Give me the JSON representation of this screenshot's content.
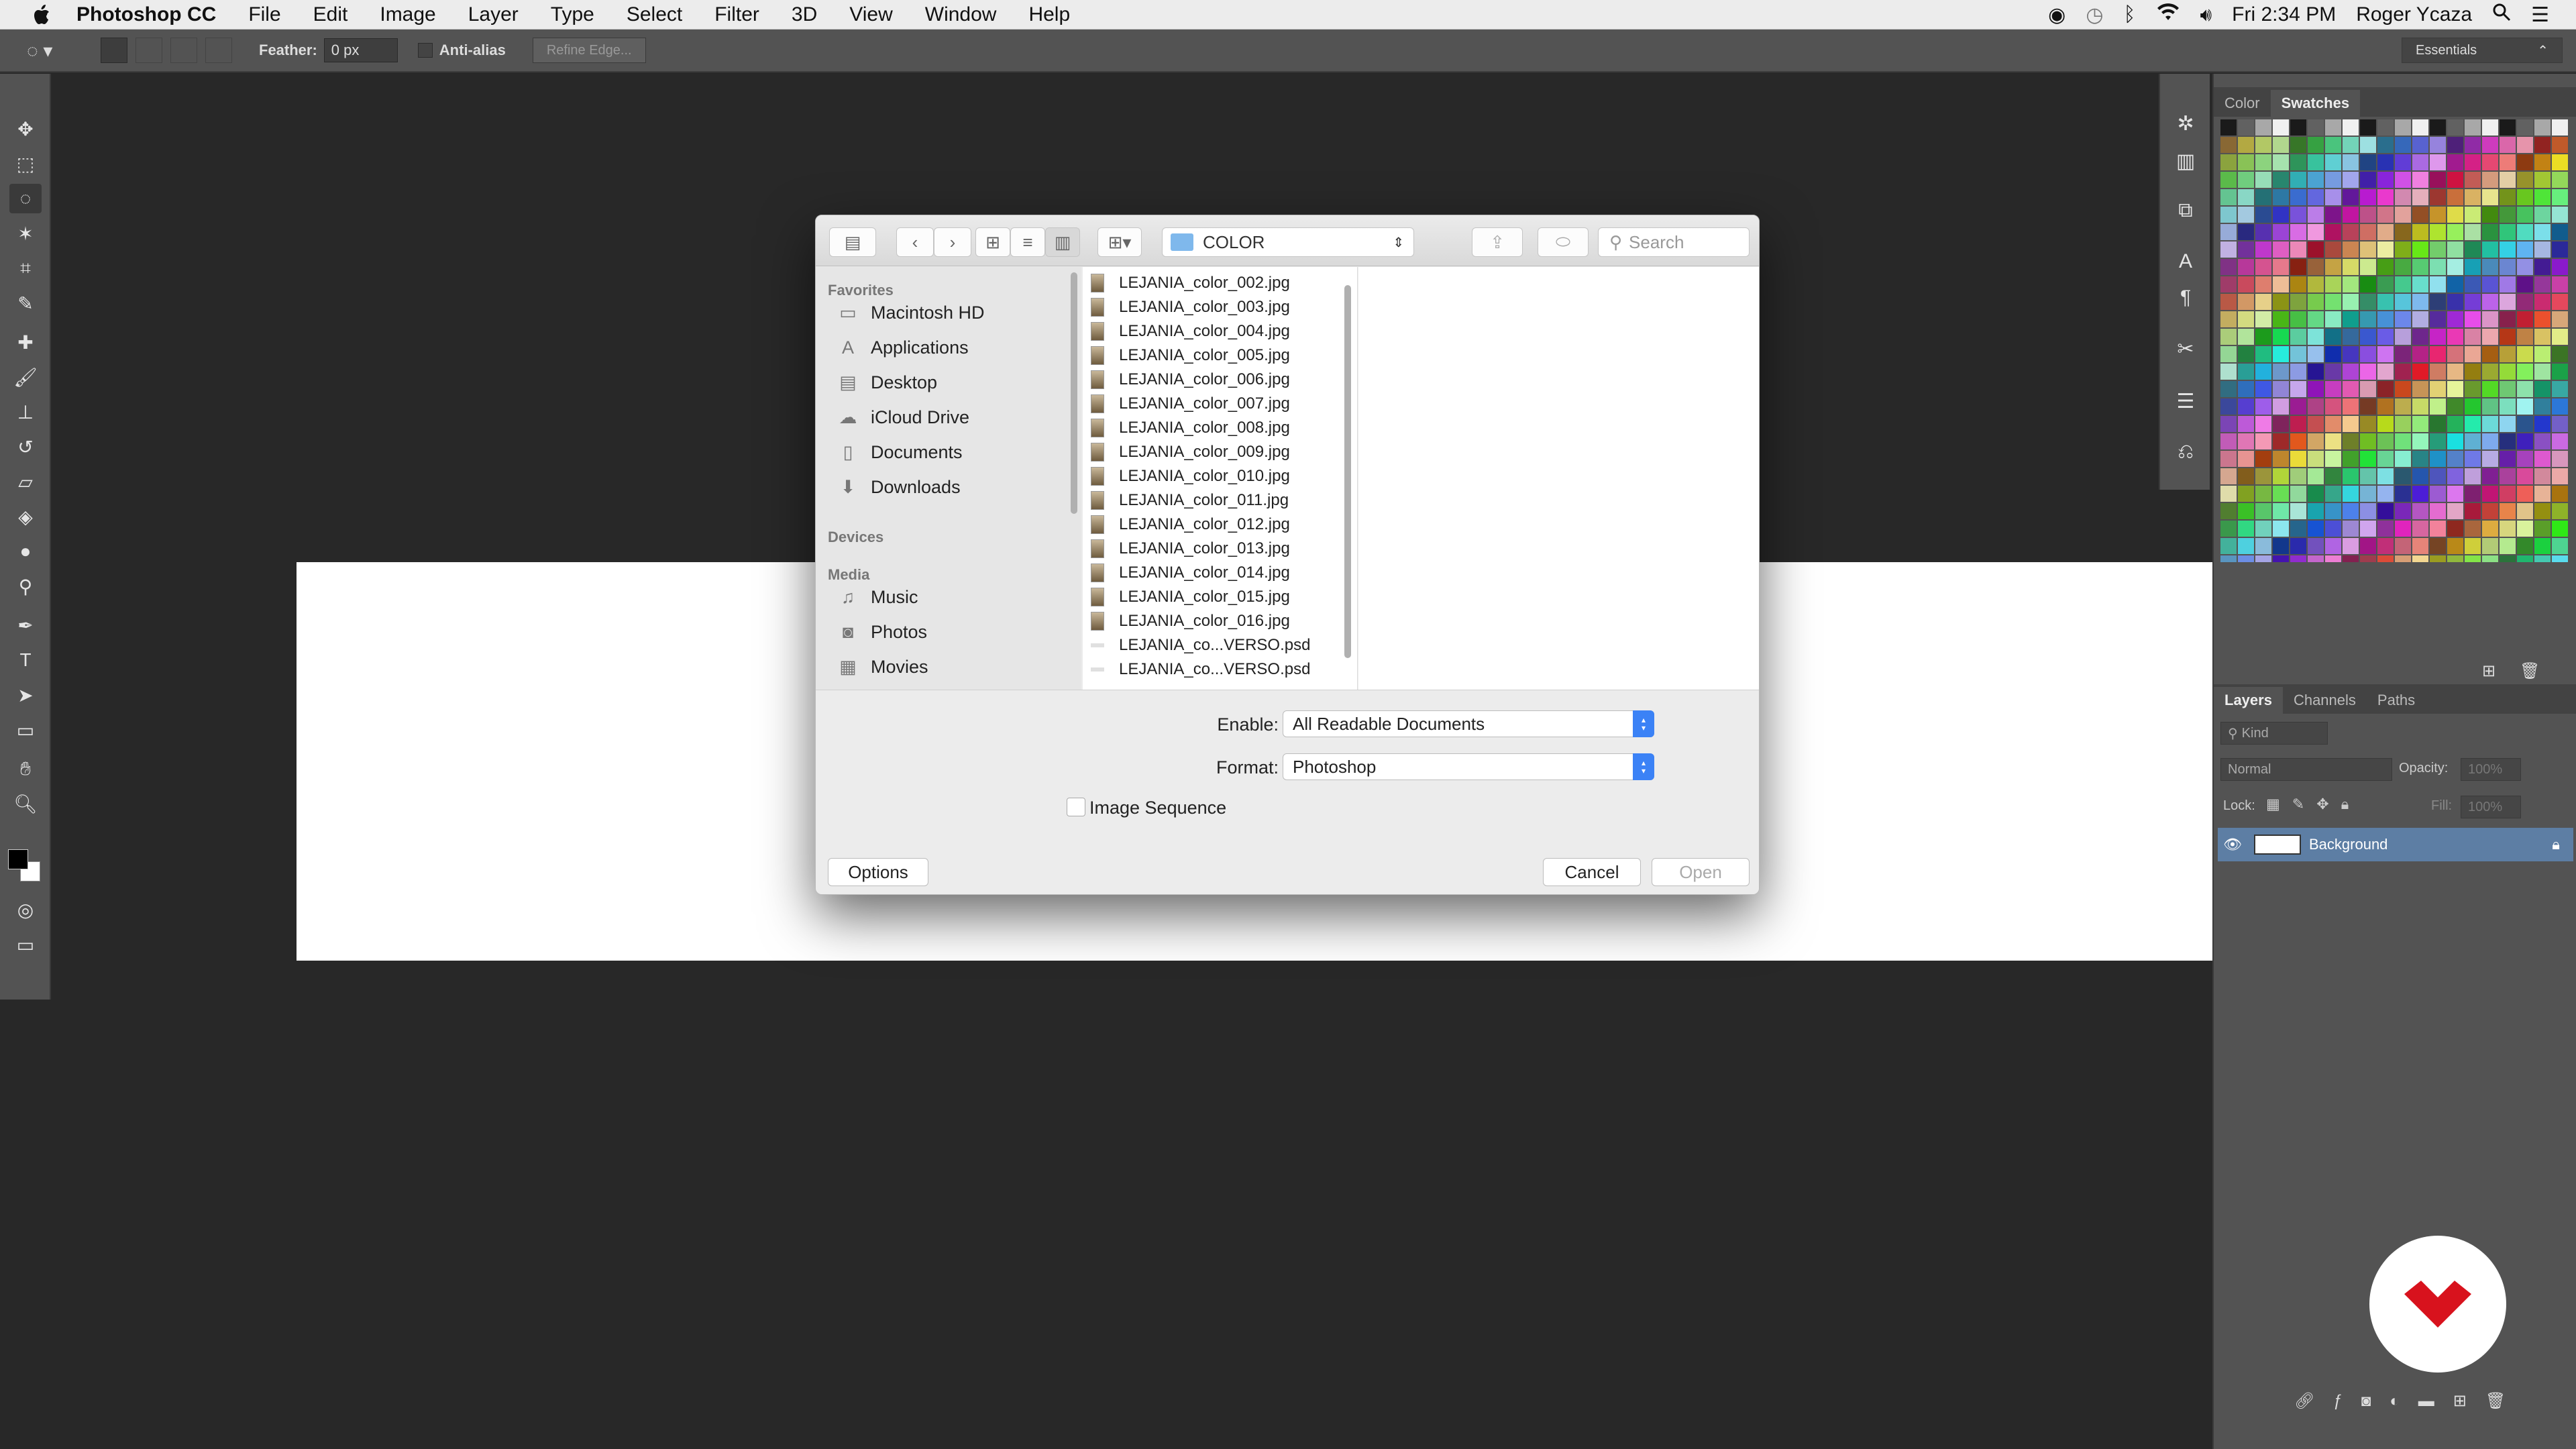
{
  "menubar": {
    "app_name": "Photoshop CC",
    "items": [
      "File",
      "Edit",
      "Image",
      "Layer",
      "Type",
      "Select",
      "Filter",
      "3D",
      "View",
      "Window",
      "Help"
    ],
    "clock": "Fri 2:34 PM",
    "user": "Roger Ycaza"
  },
  "options_bar": {
    "feather_label": "Feather:",
    "feather_value": "0 px",
    "anti_alias_label": "Anti-alias",
    "refine_edge_label": "Refine Edge...",
    "workspace": "Essentials"
  },
  "panels": {
    "color_tabs": [
      "Color",
      "Swatches"
    ],
    "layers_tabs": [
      "Layers",
      "Channels",
      "Paths"
    ],
    "kind_filter": "Kind",
    "blend_mode": "Normal",
    "opacity_label": "Opacity:",
    "opacity_value": "100%",
    "lock_label": "Lock:",
    "fill_label": "Fill:",
    "fill_value": "100%",
    "layer_name": "Background"
  },
  "dialog": {
    "location": "COLOR",
    "search_placeholder": "Search",
    "sidebar": {
      "favorites_heading": "Favorites",
      "favorites": [
        "Macintosh HD",
        "Applications",
        "Desktop",
        "iCloud Drive",
        "Documents",
        "Downloads"
      ],
      "devices_heading": "Devices",
      "media_heading": "Media",
      "media": [
        "Music",
        "Photos",
        "Movies"
      ]
    },
    "files": [
      "LEJANIA_color_002.jpg",
      "LEJANIA_color_003.jpg",
      "LEJANIA_color_004.jpg",
      "LEJANIA_color_005.jpg",
      "LEJANIA_color_006.jpg",
      "LEJANIA_color_007.jpg",
      "LEJANIA_color_008.jpg",
      "LEJANIA_color_009.jpg",
      "LEJANIA_color_010.jpg",
      "LEJANIA_color_011.jpg",
      "LEJANIA_color_012.jpg",
      "LEJANIA_color_013.jpg",
      "LEJANIA_color_014.jpg",
      "LEJANIA_color_015.jpg",
      "LEJANIA_color_016.jpg",
      "LEJANIA_co...VERSO.psd",
      "LEJANIA_co...VERSO.psd"
    ],
    "enable_label": "Enable:",
    "enable_value": "All Readable Documents",
    "format_label": "Format:",
    "format_value": "Photoshop",
    "image_sequence_label": "Image Sequence",
    "options_label": "Options",
    "cancel_label": "Cancel",
    "open_label": "Open"
  },
  "colors": {
    "accent": "#3b82f6",
    "selected_layer": "#5d7ea4",
    "logo_red": "#d8121d"
  }
}
